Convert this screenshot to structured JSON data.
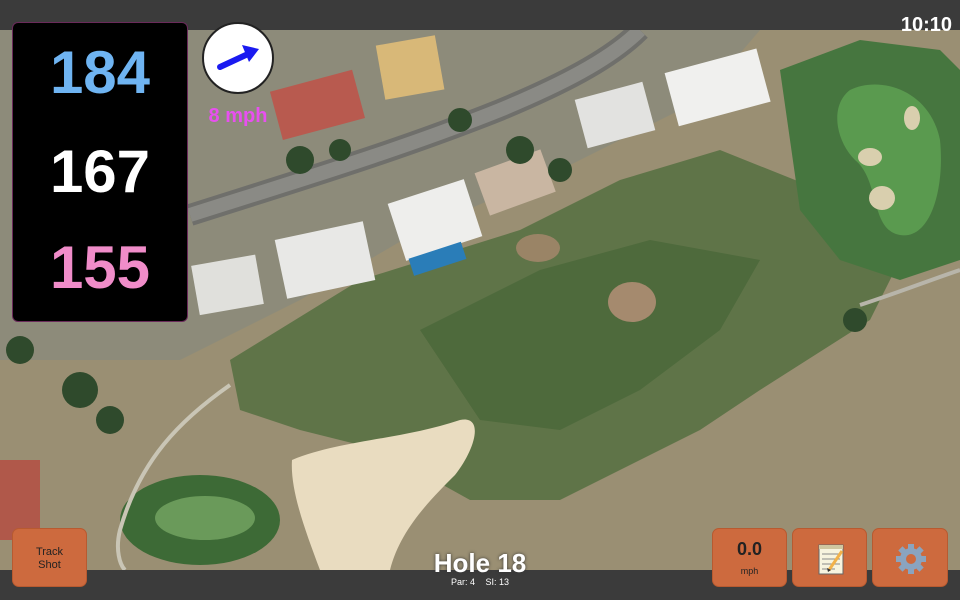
{
  "status": {
    "time": "10:10"
  },
  "distances": {
    "back": "184",
    "middle": "167",
    "front": "155"
  },
  "colors": {
    "back": "#6fb4f2",
    "middle": "#ffffff",
    "front": "#f08cc9",
    "wind": "#e84ff0",
    "button": "#cd6a3e"
  },
  "wind": {
    "speed": "8 mph",
    "icon": "wind-direction-arrow-icon"
  },
  "buttons": {
    "track_shot": "Track Shot",
    "speed_value": "0.0",
    "speed_unit": "mph",
    "notes_icon": "notepad-icon",
    "settings_icon": "gear-icon"
  },
  "hole": {
    "title": "Hole 18",
    "par": "Par: 4",
    "si": "SI: 13"
  }
}
